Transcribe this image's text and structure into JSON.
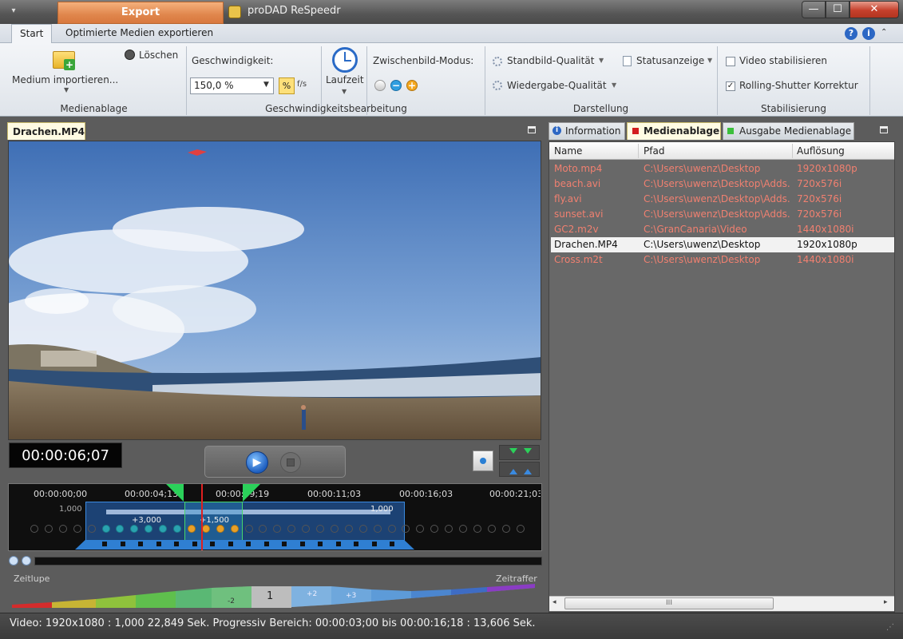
{
  "titlebar": {
    "qat_symbol": "▾",
    "context_tab": "Export",
    "app_title": "proDAD ReSpeedr",
    "min": "—",
    "max": "☐",
    "close": "✕"
  },
  "tabs": {
    "start": "Start",
    "optimized": "Optimierte Medien exportieren"
  },
  "ribbon": {
    "import_label": "Medium importieren...",
    "delete_label": "Löschen",
    "group_media": "Medienablage",
    "speed_label": "Geschwindigkeit:",
    "speed_value": "150,0 %",
    "pct_button": "%",
    "fps_button": "f/s",
    "laufzeit_label": "Laufzeit",
    "zwischenbild_label": "Zwischenbild-Modus:",
    "group_speed": "Geschwindigkeitsbearbeitung",
    "standbild_label": "Standbild-Qualität",
    "wiedergabe_label": "Wiedergabe-Qualität",
    "statusanzeige_label": "Statusanzeige",
    "group_display": "Darstellung",
    "stabilize_label": "Video stabilisieren",
    "rolling_label": "Rolling-Shutter Korrektur",
    "group_stab": "Stabilisierung",
    "stabilize_checked": false,
    "rolling_checked": true
  },
  "left": {
    "clip_tab": "Drachen.MP4",
    "timecode": "00:00:06;07"
  },
  "timeline": {
    "ticks": [
      "00:00:00;00",
      "00:00:04;13",
      "00:00:09;19",
      "00:00:11;03",
      "00:00:16;03",
      "00:00:21;03"
    ],
    "val_left": "1,000",
    "val_right": "1,000",
    "val_plus3": "+3,000",
    "val_plus15": "+1,500"
  },
  "curve": {
    "slow_label": "Zeitlupe",
    "fast_label": "Zeitraffer",
    "m2": "-2",
    "one": "1",
    "p2": "+2",
    "p3": "+3"
  },
  "right": {
    "tab_info": "Information",
    "tab_media": "Medienablage",
    "tab_output": "Ausgabe Medienablage",
    "col_name": "Name",
    "col_path": "Pfad",
    "col_res": "Auflösung",
    "rows": [
      {
        "name": "Moto.mp4",
        "path": "C:\\Users\\uwenz\\Desktop",
        "res": "1920x1080p",
        "selected": false
      },
      {
        "name": "beach.avi",
        "path": "C:\\Users\\uwenz\\Desktop\\Adds...",
        "res": "720x576i",
        "selected": false
      },
      {
        "name": "fly.avi",
        "path": "C:\\Users\\uwenz\\Desktop\\Adds...",
        "res": "720x576i",
        "selected": false
      },
      {
        "name": "sunset.avi",
        "path": "C:\\Users\\uwenz\\Desktop\\Adds...",
        "res": "720x576i",
        "selected": false
      },
      {
        "name": "GC2.m2v",
        "path": "C:\\GranCanaria\\Video",
        "res": "1440x1080i",
        "selected": false
      },
      {
        "name": "Drachen.MP4",
        "path": "C:\\Users\\uwenz\\Desktop",
        "res": "1920x1080p",
        "selected": true
      },
      {
        "name": "Cross.m2t",
        "path": "C:\\Users\\uwenz\\Desktop",
        "res": "1440x1080i",
        "selected": false
      }
    ],
    "scroll_grip": "III",
    "scroll_left": "◂",
    "scroll_right": "▸"
  },
  "status": {
    "text": "Video: 1920x1080 : 1,000   22,849 Sek.  Progressiv  Bereich: 00:00:03;00 bis 00:00:16;18 : 13,606 Sek."
  },
  "colors": {
    "accent_orange": "#e0864c",
    "selected_row": "#f2f2f2",
    "row_text": "#f08070",
    "media_tab_marker": "#d31e1e",
    "output_tab_marker": "#3bbf3b",
    "range_blue": "#2f7fd2",
    "handle_green": "#2bd15a",
    "playhead_red": "#e02020"
  }
}
